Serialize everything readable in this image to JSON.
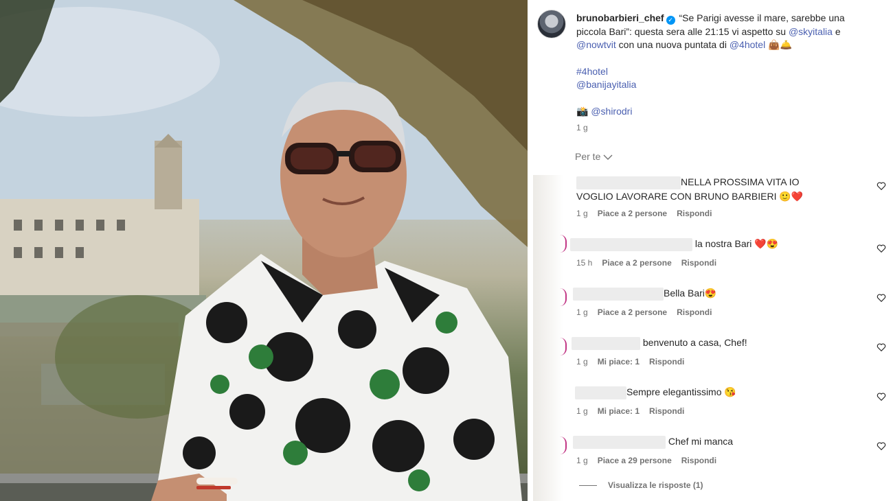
{
  "post": {
    "username": "brunobarbieri_chef",
    "caption_part1": "“Se Parigi avesse il mare, sarebbe una piccola Bari”: questa sera alle 21:15 vi aspetto su ",
    "mention_sky": "@skyitalia",
    "caption_and": " e",
    "mention_now": "@nowtvit",
    "caption_part2": " con una nuova puntata di ",
    "mention_4hotel": "@4hotel",
    "caption_emoji": " 👜🛎️",
    "hashtag": "#4hotel",
    "mention_banijay": "@banijayitalia",
    "photo_credit_icon": "📸",
    "mention_shirodri": "@shirodri",
    "time": "1 g"
  },
  "comments_sort": "Per te",
  "sort_icon": "chevron-down-icon",
  "comments": [
    {
      "text": "NELLA PROSSIMA VITA IO VOGLIO LAVORARE CON BRUNO BARBIERI 🙂❤️",
      "time": "1 g",
      "likes": "Piace a 2 persone",
      "reply": "Rispondi"
    },
    {
      "text": "la nostra Bari ❤️😍",
      "time": "15 h",
      "likes": "Piace a 2 persone",
      "reply": "Rispondi"
    },
    {
      "text": "Bella Bari😍",
      "time": "1 g",
      "likes": "Piace a 2 persone",
      "reply": "Rispondi"
    },
    {
      "text": "benvenuto a casa, Chef!",
      "time": "1 g",
      "likes": "Mi piace: 1",
      "reply": "Rispondi"
    },
    {
      "text": "Sempre elegantissimo 😘",
      "time": "1 g",
      "likes": "Mi piace: 1",
      "reply": "Rispondi"
    },
    {
      "text": "Chef mi manca",
      "time": "1 g",
      "likes": "Piace a 29 persone",
      "reply": "Rispondi"
    }
  ],
  "view_replies": "Visualizza le risposte (1)",
  "like_icon": "heart-outline-icon",
  "colors": {
    "link": "#4a5fb0",
    "muted": "#737373",
    "verified": "#0095f6",
    "story_ring": "#c13584"
  }
}
